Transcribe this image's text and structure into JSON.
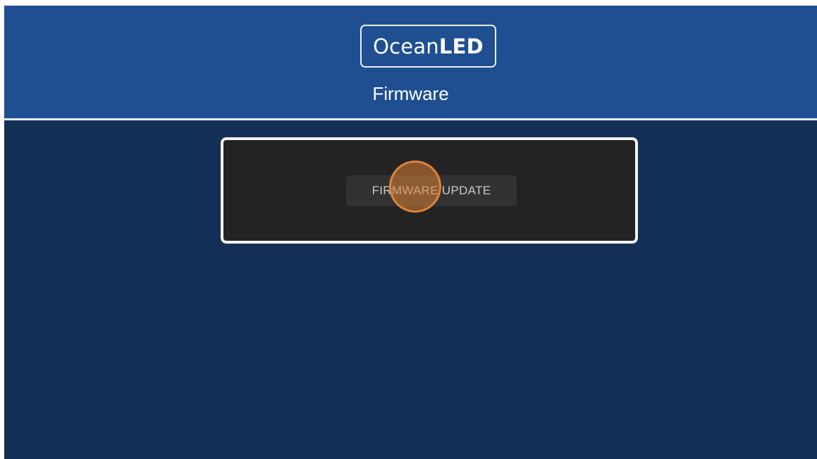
{
  "header": {
    "logo": {
      "thin_part": "Ocean",
      "bold_part": "LED"
    },
    "title": "Firmware"
  },
  "panel": {
    "firmware_update_label": "FIRMWARE UPDATE"
  },
  "colors": {
    "header_bg": "#1f4f91",
    "body_bg": "#142f55",
    "panel_bg": "#232323",
    "button_bg": "#323232",
    "touch_indicator": "#da8034"
  }
}
